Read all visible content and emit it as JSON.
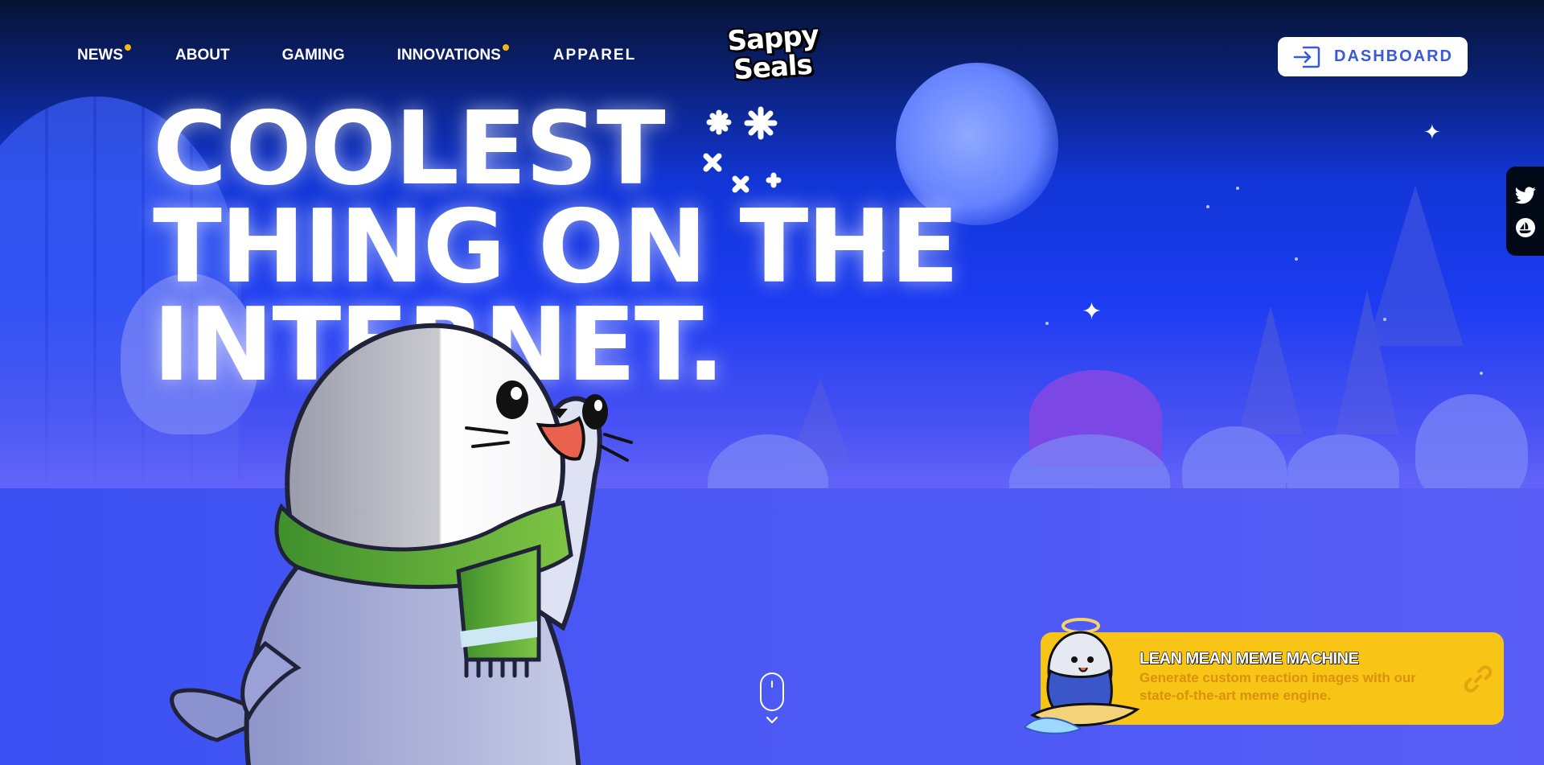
{
  "nav": {
    "items": [
      {
        "label": "NEWS",
        "has_dot": true
      },
      {
        "label": "ABOUT",
        "has_dot": false
      },
      {
        "label": "GAMING",
        "has_dot": false
      },
      {
        "label": "INNOVATIONS",
        "has_dot": true
      },
      {
        "label": "APPAREL",
        "has_dot": false
      }
    ],
    "dot_color": "#f6b80f"
  },
  "logo": {
    "line1": "Sappy",
    "line2": "Seals"
  },
  "header": {
    "dashboard_label": "DASHBOARD",
    "dashboard_icon": "login-arrow-icon"
  },
  "social": {
    "items": [
      {
        "icon": "twitter-icon"
      },
      {
        "icon": "opensea-icon"
      }
    ]
  },
  "hero": {
    "headline_line1": "COOLEST",
    "headline_line2": "THING ON THE",
    "headline_line3": "INTERNET."
  },
  "scroll": {
    "icon": "mouse-scroll-icon"
  },
  "meme_card": {
    "title": "LEAN MEAN MEME MACHINE",
    "description": "Generate custom reaction images with our state-of-the-art meme engine.",
    "icon": "link-icon",
    "bg_color": "#f8c416"
  },
  "colors": {
    "accent": "#3c5ad8",
    "hero_blue": "#1d3cf2",
    "ground_blue": "#4a58f4"
  }
}
